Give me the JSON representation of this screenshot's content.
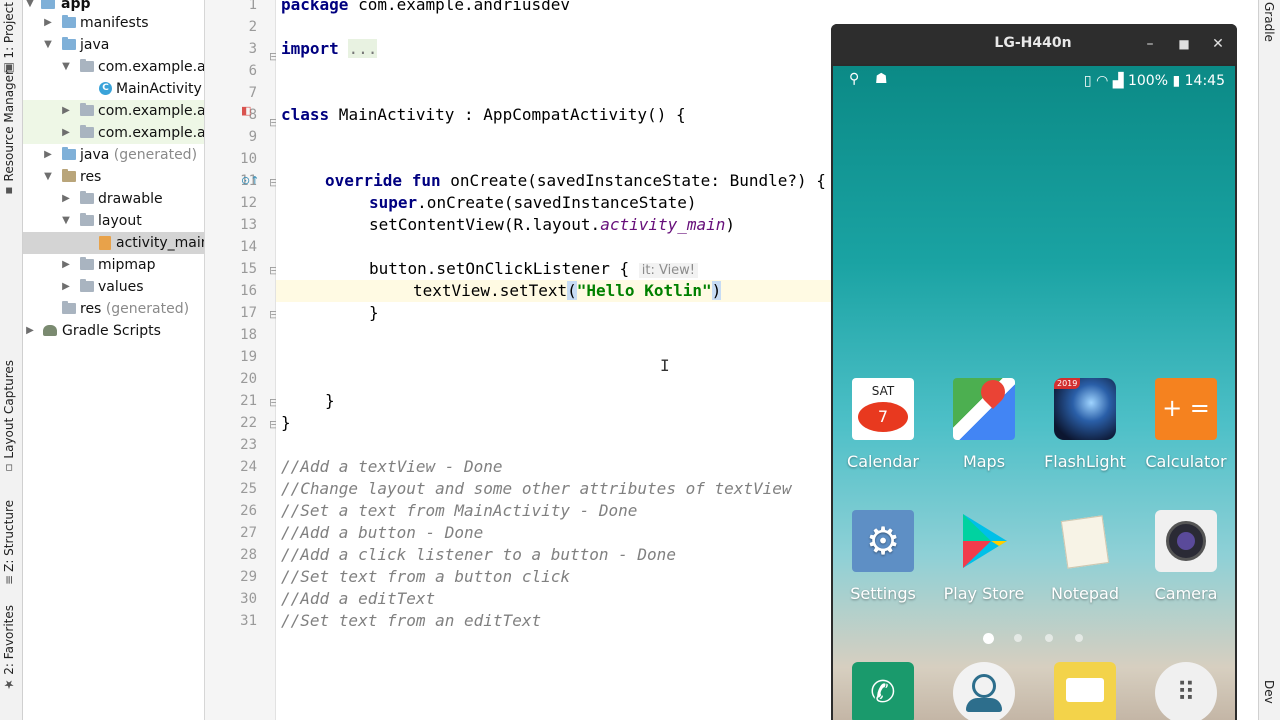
{
  "left_tabs": [
    {
      "label": "1: Project"
    },
    {
      "label": "Resource Manager"
    },
    {
      "label": "Layout Captures"
    },
    {
      "label": "Z: Structure"
    },
    {
      "label": "2: Favorites"
    }
  ],
  "right_tabs": [
    {
      "label": "Gradle"
    },
    {
      "label": "Dev"
    }
  ],
  "project_tree": [
    {
      "label": "app",
      "indent": 0
    },
    {
      "label": "manifests"
    },
    {
      "label": "java"
    },
    {
      "label": "com.example.andriusdev"
    },
    {
      "label": "MainActivity"
    },
    {
      "label": "com.example.andriusdev"
    },
    {
      "label": "com.example.andriusdev"
    },
    {
      "label": "java",
      "suffix": "(generated)"
    },
    {
      "label": "res"
    },
    {
      "label": "drawable"
    },
    {
      "label": "layout"
    },
    {
      "label": "activity_main.xml"
    },
    {
      "label": "mipmap"
    },
    {
      "label": "values"
    },
    {
      "label": "res",
      "suffix": "(generated)"
    },
    {
      "label": "Gradle Scripts"
    }
  ],
  "editor": {
    "line_numbers": [
      "1",
      "2",
      "3",
      "6",
      "7",
      "8",
      "9",
      "10",
      "11",
      "12",
      "13",
      "14",
      "15",
      "16",
      "17",
      "18",
      "19",
      "20",
      "21",
      "22",
      "23",
      "24",
      "25",
      "26",
      "27",
      "28",
      "29",
      "30",
      "31"
    ],
    "code": {
      "l1_kw": "package",
      "l1_rest": " com.example.andriusdev",
      "l3_kw": "import",
      "l3_fold": "...",
      "l8_kw": "class",
      "l8_rest": " MainActivity : AppCompatActivity() {",
      "l11_kw": "override fun",
      "l11_rest": " onCreate(savedInstanceState: Bundle?) {",
      "l12_kw": "super",
      "l12_rest": ".onCreate(savedInstanceState)",
      "l13_a": "setContentView(R.layout.",
      "l13_it": "activity_main",
      "l13_b": ")",
      "l15_a": "button.setOnClickListener {",
      "l15_hint": "it: View!",
      "l16_a": "textView.setText",
      "l16_p1": "(",
      "l16_str": "\"Hello Kotlin\"",
      "l16_p2": ")",
      "l17": "}",
      "l21": "}",
      "l22": "}",
      "comments": [
        "//Add a textView - Done",
        "//Change layout and some other attributes of textView",
        "//Set a text from MainActivity - Done",
        "//Add a button - Done",
        "//Add a click listener to a button - Done",
        "//Set text from a button click",
        "//Add a editText",
        "//Set text from an editText"
      ]
    }
  },
  "phone": {
    "title": "LG-H440n",
    "status": {
      "battery": "100%",
      "time": "14:45"
    },
    "apps_row1": [
      {
        "label": "Calendar",
        "day": "SAT",
        "date": "7"
      },
      {
        "label": "Maps"
      },
      {
        "label": "FlashLight",
        "badge": "2019"
      },
      {
        "label": "Calculator",
        "glyph": "+ ="
      }
    ],
    "apps_row2": [
      {
        "label": "Settings"
      },
      {
        "label": "Play Store"
      },
      {
        "label": "Notepad"
      },
      {
        "label": "Camera"
      }
    ],
    "colors": {
      "calculator": "#f5821f",
      "calendar_red": "#e8391f",
      "phone_green": "#1a9a6c",
      "memo_yellow": "#f3d34a"
    }
  }
}
